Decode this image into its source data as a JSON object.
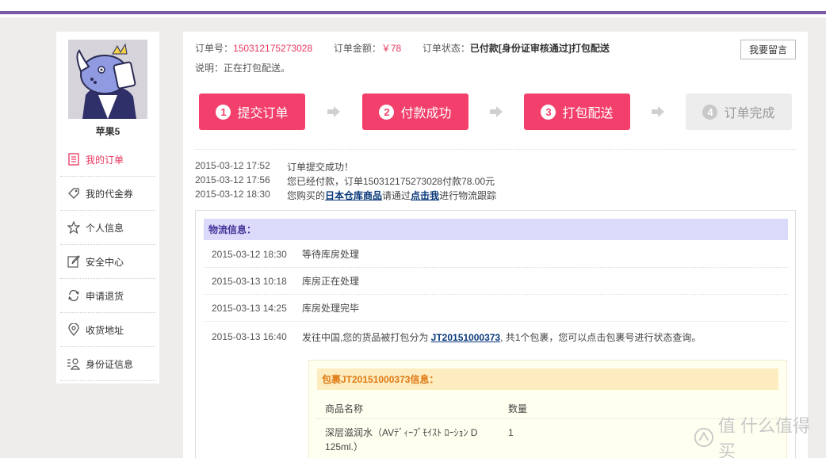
{
  "sidebar": {
    "username": "苹果5",
    "items": [
      {
        "label": "我的订单",
        "icon": "order-list-icon",
        "active": true
      },
      {
        "label": "我的代金券",
        "icon": "coupon-tag-icon"
      },
      {
        "label": "个人信息",
        "icon": "star-icon"
      },
      {
        "label": "安全中心",
        "icon": "edit-pencil-icon"
      },
      {
        "label": "申请退货",
        "icon": "refresh-icon"
      },
      {
        "label": "收货地址",
        "icon": "location-pin-icon"
      },
      {
        "label": "身份证信息",
        "icon": "id-card-icon"
      }
    ]
  },
  "order": {
    "number_label": "订单号：",
    "number": "150312175273028",
    "amount_label": "订单金额：",
    "amount": "￥78",
    "status_label": "订单状态：",
    "status": "已付款[身份证审核通过]打包配送",
    "note": "说明：正在打包配送。",
    "message_button": "我要留言"
  },
  "steps": [
    {
      "num": "1",
      "label": "提交订单",
      "done": true
    },
    {
      "num": "2",
      "label": "付款成功",
      "done": true
    },
    {
      "num": "3",
      "label": "打包配送",
      "done": true
    },
    {
      "num": "4",
      "label": "订单完成",
      "done": false
    }
  ],
  "timeline": [
    {
      "time": "2015-03-12 17:52",
      "text": "订单提交成功！"
    },
    {
      "time": "2015-03-12 17:56",
      "text": "您已经付款，订单150312175273028付款78.00元"
    },
    {
      "time": "2015-03-12 18:30",
      "pre": "您购买的",
      "link1": "日本仓库商品",
      "mid": "请通过",
      "link2": "点击我",
      "post": "进行物流跟踪"
    }
  ],
  "logistics": {
    "title": "物流信息：",
    "rows": [
      {
        "time": "2015-03-12 18:30",
        "text": "等待库房处理"
      },
      {
        "time": "2015-03-13 10:18",
        "text": "库房正在处理"
      },
      {
        "time": "2015-03-13 14:25",
        "text": "库房处理完毕"
      },
      {
        "time": "2015-03-13 16:40",
        "pre": "发往中国,您的货品被打包分为 ",
        "link": "JT20151000373",
        "post": ", 共1个包裹，您可以点击包裹号进行状态查询。"
      }
    ]
  },
  "package": {
    "title": "包裹JT20151000373信息：",
    "col_name": "商品名称",
    "col_qty": "数量",
    "items": [
      {
        "name": "深层滋润水（AVﾃﾞｨｰﾌﾟﾓｲｽﾄ ﾛｰｼｮﾝ D 125ml.）",
        "qty": "1"
      }
    ]
  },
  "watermark": "值 什么值得买",
  "colors": {
    "accent": "#f23f6b",
    "purple_bar": "#7b5aa6",
    "link": "#0a3a7a"
  }
}
